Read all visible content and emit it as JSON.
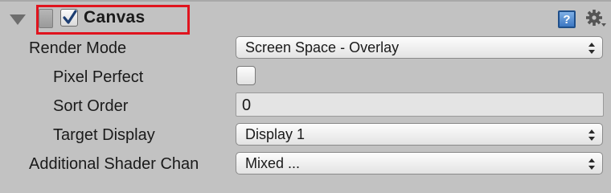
{
  "component": {
    "title": "Canvas",
    "enabled": true,
    "help_glyph": "?",
    "icons": [
      "foldout-arrow-icon",
      "canvas-component-icon",
      "checkmark-icon",
      "help-icon",
      "gear-icon"
    ]
  },
  "highlight_color": "#e0141e",
  "fields": {
    "render_mode": {
      "label": "Render Mode",
      "value": "Screen Space - Overlay"
    },
    "pixel_perfect": {
      "label": "Pixel Perfect",
      "checked": false
    },
    "sort_order": {
      "label": "Sort Order",
      "value": "0"
    },
    "target_display": {
      "label": "Target Display",
      "value": "Display 1"
    },
    "shader_channels": {
      "label": "Additional Shader Chan",
      "value": "Mixed ..."
    }
  }
}
